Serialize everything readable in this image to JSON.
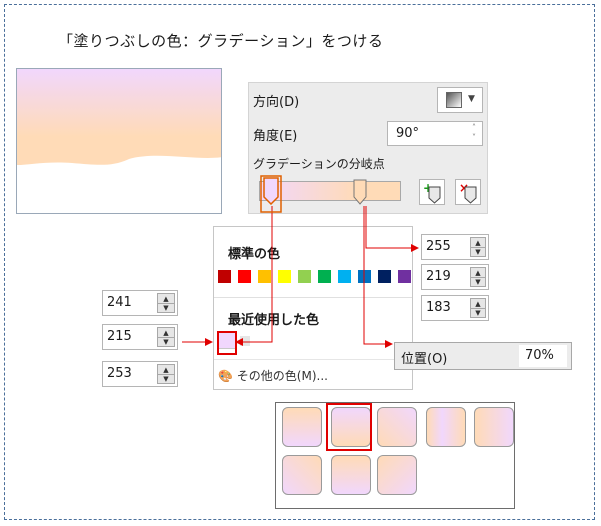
{
  "title": "「塗りつぶしの色：グラデーション」をつける",
  "colors": {
    "stop1": "#f1d7fd",
    "stop2": "#ffdbb7",
    "highlight": "#e00000",
    "frame": "#4a6f9a"
  },
  "panel": {
    "direction_label": "方向(D)",
    "angle_label": "角度(E)",
    "angle_value": "90°",
    "stops_label": "グラデーションの分岐点",
    "add_stop_icon": "add-gradient-stop-icon",
    "remove_stop_icon": "remove-gradient-stop-icon"
  },
  "color_popup": {
    "standard_label": "標準の色",
    "standard_colors": [
      "#c00000",
      "#ff0000",
      "#ffc000",
      "#ffff00",
      "#92d050",
      "#00b050",
      "#00b0f0",
      "#0070c0",
      "#002060",
      "#7030a0"
    ],
    "recent_label": "最近使用した色",
    "more_colors": "その他の色(M)..."
  },
  "rgb_left": {
    "r": "241",
    "g": "215",
    "b": "253"
  },
  "rgb_right": {
    "r": "255",
    "g": "219",
    "b": "183"
  },
  "position": {
    "label": "位置(O)",
    "value": "70%"
  },
  "gallery": {
    "selected_index": 1
  }
}
